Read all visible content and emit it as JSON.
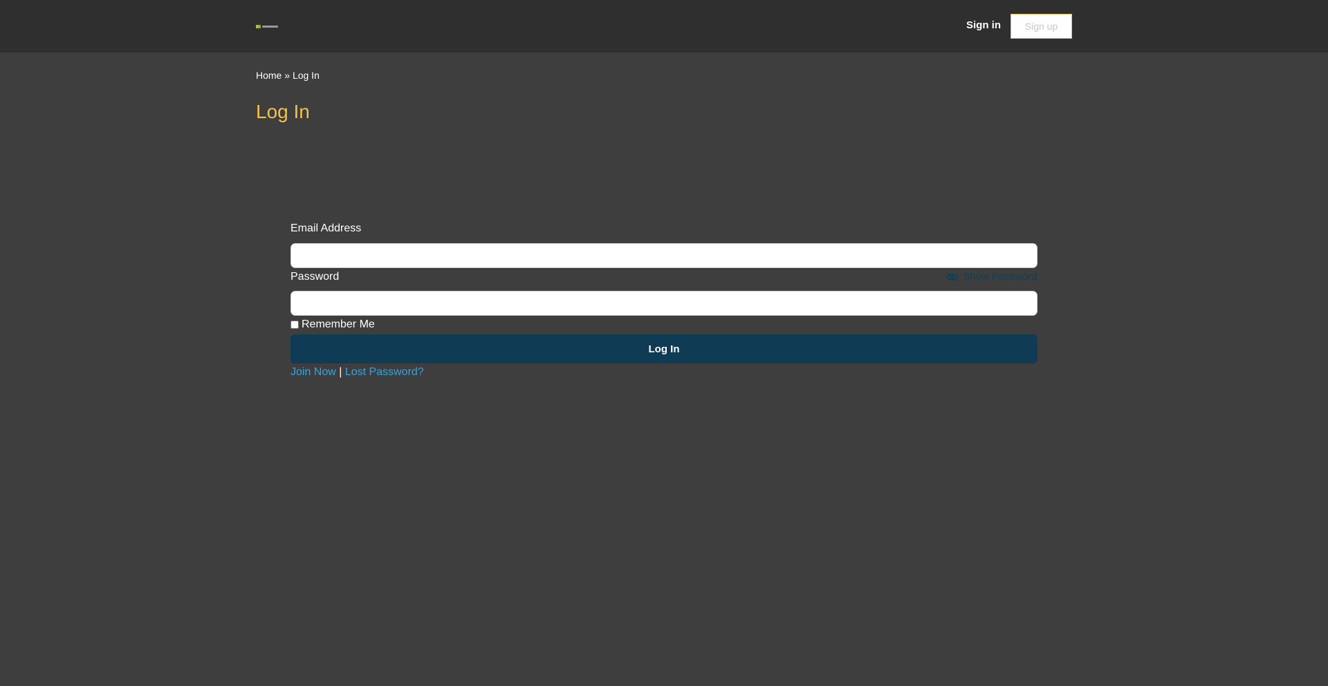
{
  "header": {
    "sign_in_label": "Sign in",
    "sign_up_label": "Sign up"
  },
  "breadcrumb": {
    "home": "Home",
    "separator": " » ",
    "current": "Log In"
  },
  "page": {
    "title": "Log In"
  },
  "form": {
    "email_label": "Email Address",
    "email_value": "",
    "password_label": "Password",
    "password_value": "",
    "show_password_label": "Show Password",
    "remember_label": "Remember Me",
    "remember_checked": false,
    "submit_label": "Log In",
    "join_label": "Join Now",
    "links_separator": " | ",
    "lost_password_label": "Lost Password?"
  },
  "colors": {
    "page_background": "#3e3e3e",
    "header_background": "#2f2f2f",
    "title_accent": "#f1c24e",
    "button_primary": "#0f3c54",
    "link": "#2fa5e6"
  },
  "icons": {
    "logo": "site-logo",
    "show_password": "eye-slash-icon"
  }
}
